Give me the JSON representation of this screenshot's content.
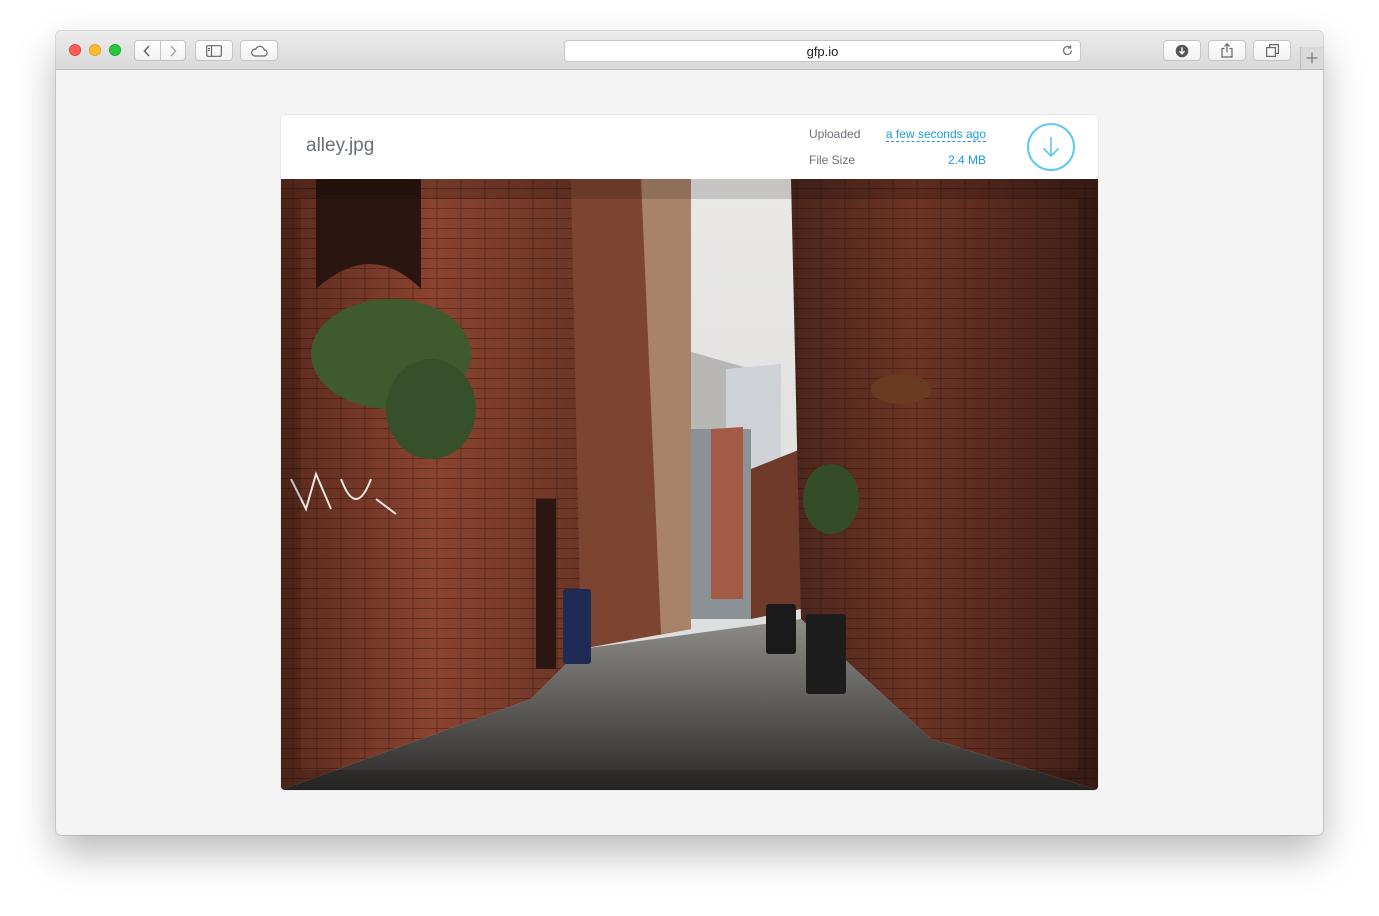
{
  "browser": {
    "url": "gfp.io",
    "icons": {
      "back": "chevron-left-icon",
      "forward": "chevron-right-icon",
      "sidebar": "sidebar-icon",
      "cloud": "icloud-tabs-icon",
      "reload": "reload-icon",
      "downloads": "download-circle-icon",
      "share": "share-icon",
      "tabs": "tab-overview-icon",
      "new_tab": "plus-icon"
    }
  },
  "file": {
    "name": "alley.jpg",
    "uploaded_label": "Uploaded",
    "uploaded_value": "a few seconds ago",
    "size_label": "File Size",
    "size_value": "2.4 MB",
    "image_subject": "brick alley photograph"
  },
  "colors": {
    "accent": "#1e9ae0",
    "download_ring": "#5ec8f0",
    "page_bg": "#f4f4f4"
  }
}
